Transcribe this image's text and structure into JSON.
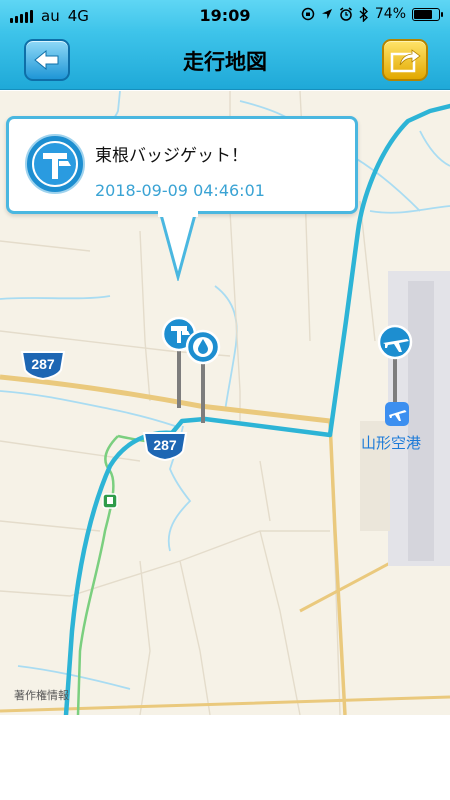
{
  "status_bar": {
    "carrier": "au",
    "network": "4G",
    "time": "19:09",
    "battery": "74%",
    "battery_level": 0.74
  },
  "navbar": {
    "title": "走行地図",
    "back_icon": "arrow-left-icon",
    "share_icon": "share-arrow-icon"
  },
  "map": {
    "callout": {
      "message": "東根バッジゲット！",
      "timestamp": "2018-09-09 04:46:01"
    },
    "route_shields": [
      "287",
      "287"
    ],
    "airport_label": "山形空港",
    "credit": "著作権情報",
    "colors": {
      "route": "#2db4d6",
      "land": "#f6f2e7",
      "water": "#a9dcf2",
      "shield": "#1d66b3",
      "accent": "#4ab7e0"
    }
  }
}
